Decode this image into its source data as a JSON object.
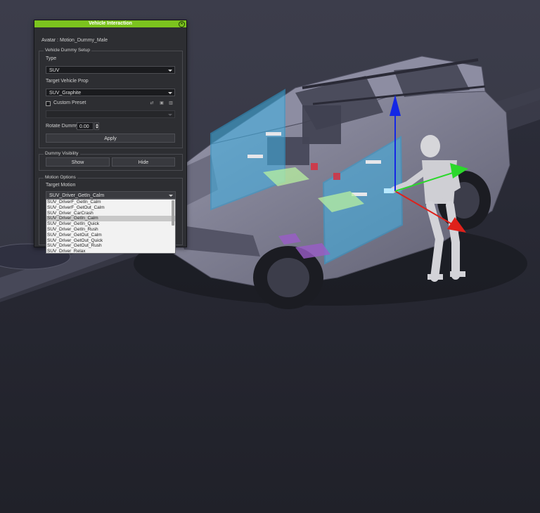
{
  "panel": {
    "title": "Vehicle Interaction",
    "avatar_label": "Avatar : Motion_Dummy_Male",
    "setup_group": "Vehicle Dummy Setup",
    "type_label": "Type",
    "type_value": "SUV",
    "target_prop_label": "Target Vehicle Prop",
    "target_prop_value": "SUV_Graphite",
    "custom_preset_label": "Custom Preset",
    "custom_preset_checked": false,
    "rotate_label": "Rotate Dummy",
    "rotate_value": "0.00",
    "apply_label": "Apply",
    "visibility_group": "Dummy Visibility",
    "show_label": "Show",
    "hide_label": "Hide",
    "motion_group": "Motion Options",
    "target_motion_label": "Target Motion",
    "target_motion_value": "SUV_Driver_GetIn_Calm",
    "motion_options": [
      "SUV_DriverF_GetIn_Calm",
      "SUV_DriverF_GetOut_Calm",
      "SUV_Driver_CarCrash",
      "SUV_Driver_GetIn_Calm",
      "SUV_Driver_GetIn_Quick",
      "SUV_Driver_GetIn_Rush",
      "SUV_Driver_GetOut_Calm",
      "SUV_Driver_GetOut_Quick",
      "SUV_Driver_GetOut_Rush",
      "SUV_Driver_Relax"
    ],
    "selected_motion_index": 3
  },
  "icons": {
    "close": "close-circle-icon",
    "preset_ops": [
      "swap-icon",
      "save-icon",
      "trash-icon"
    ]
  },
  "colors": {
    "title_bar": "#7cc41e",
    "panel_bg": "#2d2e32",
    "gizmo_x": "#e0201a",
    "gizmo_y": "#2bd82b",
    "gizmo_z": "#1427e6",
    "door_highlight": "#40b4e8",
    "seat_marker": "#b8f0a0"
  }
}
